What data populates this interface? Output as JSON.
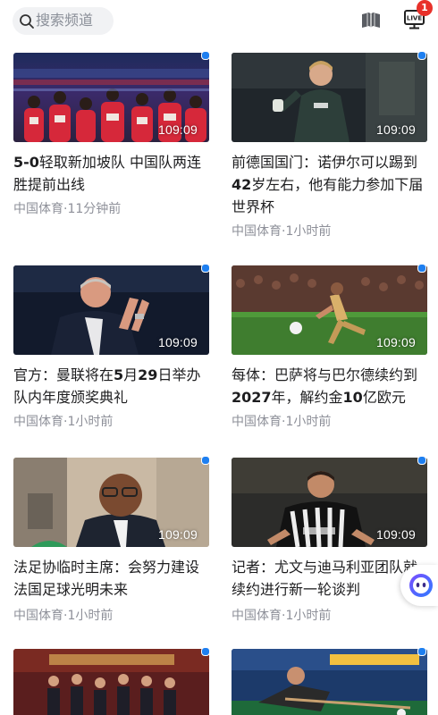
{
  "search": {
    "placeholder": "搜索频道"
  },
  "header": {
    "live_badge_count": "1",
    "live_label": "LIVE"
  },
  "cards": [
    {
      "title_pre": "5-0",
      "title_rest": "轻取新加坡队 中国队两连胜提前出线",
      "duration": "109:09",
      "source": "中国体育",
      "time": "11分钟前"
    },
    {
      "title_pre": "前德国国门：诺伊尔可以踢到",
      "title_bold": "42",
      "title_rest": "岁左右，他有能力参加下届世界杯",
      "duration": "109:09",
      "source": "中国体育",
      "time": "1小时前"
    },
    {
      "title_pre": "官方：曼联将在",
      "title_bold": "5",
      "title_mid": "月",
      "title_bold2": "29",
      "title_rest": "日举办队内年度颁奖典礼",
      "duration": "109:09",
      "source": "中国体育",
      "time": "1小时前"
    },
    {
      "title_pre": "每体：巴萨将与巴尔德续约到",
      "title_bold": "2027",
      "title_mid": "年，解约金",
      "title_bold2": "10",
      "title_rest": "亿欧元",
      "duration": "109:09",
      "source": "中国体育",
      "time": "1小时前"
    },
    {
      "title_pre": "法足协临时主席：会努力建设法国足球光明未来",
      "duration": "109:09",
      "source": "中国体育",
      "time": "1小时前"
    },
    {
      "title_pre": "记者：尤文与迪马利亚团队就续约进行新一轮谈判",
      "duration": "109:09",
      "source": "中国体育",
      "time": "1小时前"
    },
    {
      "title_pre": "",
      "duration": "",
      "source": "",
      "time": ""
    },
    {
      "title_pre": "",
      "duration": "",
      "source": "",
      "time": ""
    }
  ],
  "meta_separator": "·",
  "colors": {
    "accent_dot": "#1e7ff0",
    "badge": "#e8312a",
    "meta_text": "#8e9099",
    "title_text": "#1d1d1f"
  },
  "icons": [
    "search-icon",
    "book-icon",
    "live-tv-icon",
    "assistant-icon"
  ]
}
